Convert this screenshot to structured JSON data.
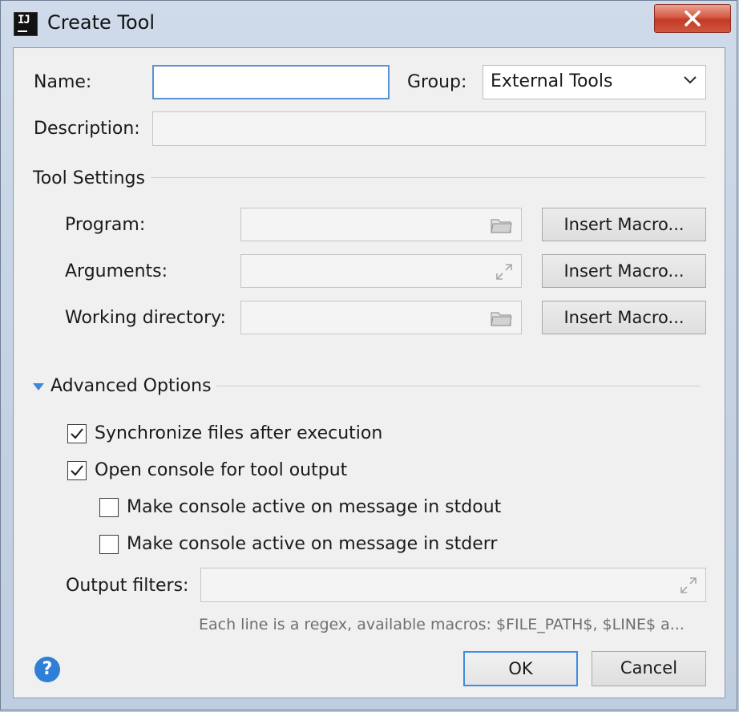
{
  "window": {
    "title": "Create Tool",
    "app_icon_text": "IJ"
  },
  "form": {
    "name_label": "Name:",
    "name_value": "",
    "group_label": "Group:",
    "group_value": "External Tools",
    "description_label": "Description:",
    "description_value": ""
  },
  "tool_settings": {
    "header": "Tool Settings",
    "program_label": "Program:",
    "program_value": "",
    "arguments_label": "Arguments:",
    "arguments_value": "",
    "working_directory_label": "Working directory:",
    "working_directory_value": "",
    "insert_macro_label": "Insert Macro..."
  },
  "advanced": {
    "header": "Advanced Options",
    "expanded": true,
    "options": [
      {
        "label": "Synchronize files after execution",
        "checked": true
      },
      {
        "label": "Open console for tool output",
        "checked": true
      },
      {
        "label": "Make console active on message in stdout",
        "checked": false
      },
      {
        "label": "Make console active on message in stderr",
        "checked": false
      }
    ],
    "output_filters_label": "Output filters:",
    "output_filters_value": "",
    "output_filters_hint": "Each line is a regex, available macros: $FILE_PATH$, $LINE$ a..."
  },
  "footer": {
    "help_label": "?",
    "ok_label": "OK",
    "cancel_label": "Cancel"
  },
  "icons": {
    "program_browse": "folder-icon",
    "arguments_expand": "expand-icon",
    "working_directory_browse": "folder-icon",
    "output_filters_expand": "expand-icon",
    "group_dropdown": "chevron-down-icon",
    "window_close": "close-icon",
    "help": "help-icon"
  },
  "colors": {
    "close_button": "#c9432c",
    "focus_border": "#5a93d2",
    "default_button_border": "#3d8ee0",
    "help_icon": "#2f7fd7",
    "triangle_accent": "#3f88d8"
  }
}
